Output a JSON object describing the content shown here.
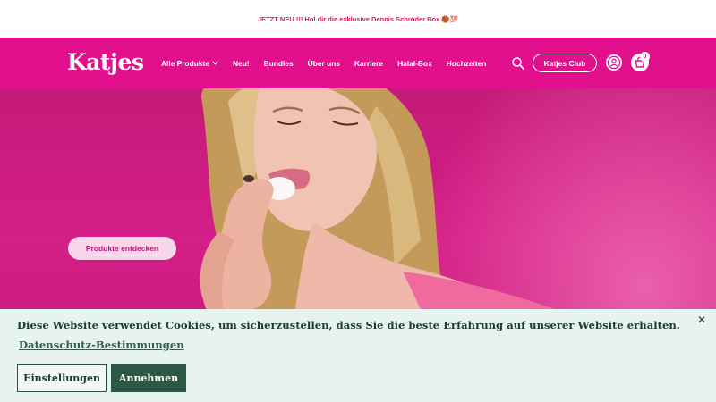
{
  "announcement": {
    "text": "JETZT NEU !!! Hol dir die exklusive Dennis Schröder Box 🏀💯"
  },
  "header": {
    "logo": "Katjes",
    "nav": [
      {
        "label": "Alle Produkte"
      },
      {
        "label": "Neu!"
      },
      {
        "label": "Bundles"
      },
      {
        "label": "Über uns"
      },
      {
        "label": "Karriere"
      },
      {
        "label": "Halal-Box"
      },
      {
        "label": "Hochzeiten"
      }
    ],
    "club_label": "Katjes Club",
    "cart_count": "0",
    "icons": [
      "search-icon",
      "account-icon",
      "cart-icon",
      "chevron-down-icon"
    ]
  },
  "hero": {
    "cta_label": "Produkte entdecken"
  },
  "cookie_banner": {
    "message": "Diese Website verwendet Cookies, um sicherzustellen, dass Sie die beste Erfahrung auf unserer Website erhalten.",
    "privacy_link": "Datenschutz-Bestimmungen",
    "settings_label": "Einstellungen",
    "accept_label": "Annehmen",
    "close_symbol": "✕"
  },
  "colors": {
    "brand_pink": "#e3108e",
    "hero_pink": "#d51e88",
    "banner_bg": "#e6f3ee",
    "accept_green": "#2d5846",
    "announce_red": "#d9145f"
  }
}
